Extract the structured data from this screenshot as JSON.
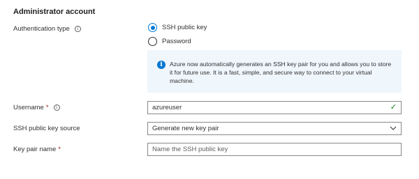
{
  "section": {
    "title": "Administrator account"
  },
  "auth": {
    "label": "Authentication type",
    "options": [
      {
        "label": "SSH public key",
        "selected": true
      },
      {
        "label": "Password",
        "selected": false
      }
    ]
  },
  "info": {
    "message": "Azure now automatically generates an SSH key pair for you and allows you to store it for future use. It is a fast, simple, and secure way to connect to your virtual machine."
  },
  "username": {
    "label": "Username",
    "required_mark": "*",
    "value": "azureuser"
  },
  "ssh_source": {
    "label": "SSH public key source",
    "value": "Generate new key pair"
  },
  "key_pair_name": {
    "label": "Key pair name",
    "required_mark": "*",
    "placeholder": "Name the SSH public key"
  },
  "colors": {
    "accent": "#0078d4",
    "valid": "#107c10",
    "required": "#a4262c",
    "info_bg": "#eff6fc"
  }
}
